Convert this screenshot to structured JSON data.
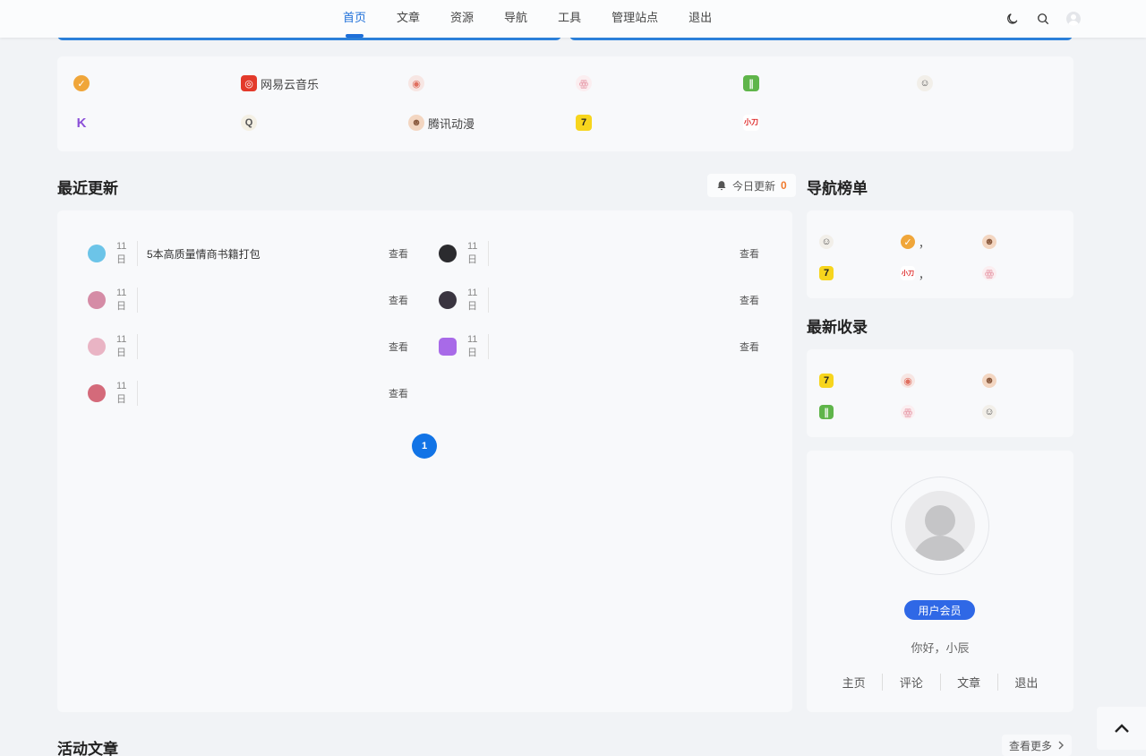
{
  "nav": {
    "items": [
      {
        "label": "首页",
        "active": true
      },
      {
        "label": "文章",
        "active": false
      },
      {
        "label": "资源",
        "active": false
      },
      {
        "label": "导航",
        "active": false
      },
      {
        "label": "工具",
        "active": false
      },
      {
        "label": "管理站点",
        "active": false
      },
      {
        "label": "退出",
        "active": false
      }
    ],
    "tools": [
      "moon-icon",
      "search-icon",
      "user-avatar"
    ]
  },
  "quick_links": {
    "row1": [
      {
        "icon": "orange-badge-icon",
        "label": ""
      },
      {
        "icon": "netease-music-icon",
        "label": "网易云音乐"
      },
      {
        "icon": "target-icon",
        "label": ""
      },
      {
        "icon": "pig-icon",
        "label": ""
      },
      {
        "icon": "green-leaf-icon",
        "label": ""
      },
      {
        "icon": "character-icon",
        "label": ""
      }
    ],
    "row2": [
      {
        "icon": "k-letter-icon",
        "label": ""
      },
      {
        "icon": "crown-q-icon",
        "label": ""
      },
      {
        "icon": "monkey-icon",
        "label": "腾讯动漫"
      },
      {
        "icon": "seven-icon",
        "label": ""
      },
      {
        "icon": "xiaodao-icon",
        "label": ""
      }
    ]
  },
  "recent": {
    "title": "最近更新",
    "today_label": "今日更新",
    "today_count": "0",
    "left": [
      {
        "date": "11日",
        "title": "5本高质量情商书籍打包",
        "view": "查看",
        "color": "#6cc4e8"
      },
      {
        "date": "11日",
        "title": "",
        "view": "查看",
        "color": "#d58ca6"
      },
      {
        "date": "11日",
        "title": "",
        "view": "查看",
        "color": "#e9b4c4"
      },
      {
        "date": "11日",
        "title": "",
        "view": "查看",
        "color": "#d46a7a"
      }
    ],
    "right": [
      {
        "date": "11日",
        "title": "",
        "view": "查看",
        "color": "#2b2b2e"
      },
      {
        "date": "11日",
        "title": "",
        "view": "查看",
        "color": "#3a3540"
      },
      {
        "date": "11日",
        "title": "",
        "view": "查看",
        "color": "#a86ae8"
      }
    ],
    "page": "1"
  },
  "nav_rank": {
    "title": "导航榜单",
    "items": [
      {
        "icon": "character-icon",
        "label": ""
      },
      {
        "icon": "orange-badge-icon",
        "label": "，"
      },
      {
        "icon": "monkey-icon",
        "label": ""
      },
      {
        "icon": "seven-icon",
        "label": ""
      },
      {
        "icon": "xiaodao-icon",
        "label": "，"
      },
      {
        "icon": "pig-icon",
        "label": ""
      }
    ]
  },
  "latest": {
    "title": "最新收录",
    "items": [
      {
        "icon": "seven-icon"
      },
      {
        "icon": "target-icon"
      },
      {
        "icon": "monkey-icon"
      },
      {
        "icon": "green-leaf-icon"
      },
      {
        "icon": "pig-icon"
      },
      {
        "icon": "character-icon"
      }
    ]
  },
  "profile": {
    "member_label": "用户会员",
    "greeting": "你好，小辰",
    "links": [
      "主页",
      "评论",
      "文章",
      "退出"
    ]
  },
  "active_articles": {
    "title": "活动文章",
    "more_label": "查看更多"
  },
  "colors": {
    "accent": "#1e6fd9",
    "member": "#2f68e6",
    "today_count": "#f07a2e"
  }
}
